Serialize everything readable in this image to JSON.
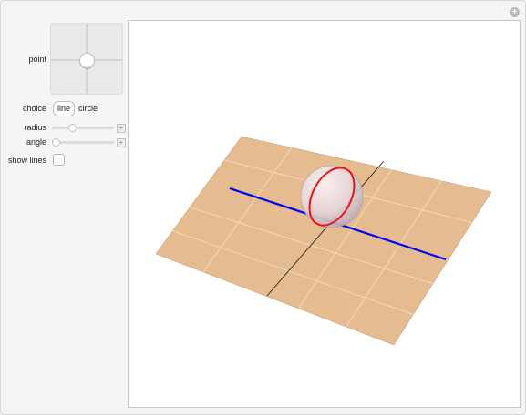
{
  "controls": {
    "point_label": "point",
    "choice_label": "choice",
    "choice_options": [
      "line",
      "circle"
    ],
    "choice_selected": "line",
    "radius_label": "radius",
    "radius_value": 0.3,
    "angle_label": "angle",
    "angle_value": 0.0,
    "show_lines_label": "show lines",
    "show_lines_checked": false
  },
  "icons": {
    "expand": "plus-icon",
    "slider_expand": "plus-icon"
  },
  "colors": {
    "plane_fill": "#e5bc8f",
    "grid_line": "#f3dcc4",
    "axis_line": "#222222",
    "line_color": "#0000ee",
    "circle_color": "#ee1111",
    "sphere_fill": "#e4d2d6"
  }
}
